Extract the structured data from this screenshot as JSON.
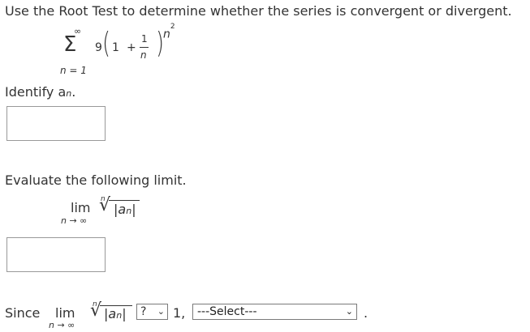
{
  "prompt": "Use the Root Test to determine whether the series is convergent or divergent.",
  "series": {
    "sum_upper": "∞",
    "sum_lower": "n = 1",
    "coefficient": "9",
    "base_one": "1",
    "plus": "+",
    "frac_num": "1",
    "frac_den": "n",
    "exponent_base": "n",
    "exponent_power": "2"
  },
  "identify": {
    "label": "Identify a",
    "sub": "n",
    "period": "."
  },
  "evaluate": {
    "label": "Evaluate the following limit.",
    "lim": "lim",
    "lim_sub": "n → ∞",
    "root_index": "n",
    "abs_expr": "|a",
    "abs_sub": "n",
    "abs_close": "|"
  },
  "conclusion": {
    "since": "Since",
    "lim": "lim",
    "lim_sub": "n → ∞",
    "root_index": "n",
    "abs_expr": "|a",
    "abs_sub": "n",
    "abs_close": "|",
    "compare_select": "?",
    "one_comma": "1,",
    "result_select": "---Select---",
    "period": "."
  },
  "icons": {
    "dropdown": "chevron-down-icon"
  }
}
